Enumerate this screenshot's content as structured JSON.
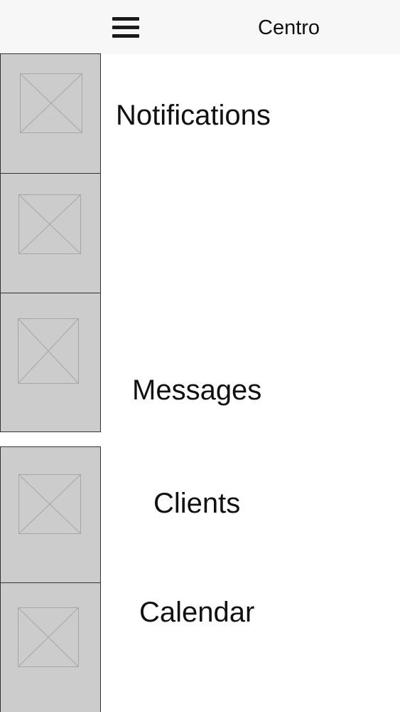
{
  "header": {
    "title": "Centro",
    "menu_icon": "hamburger-menu-icon"
  },
  "menu": {
    "items": [
      {
        "label": "Notifications",
        "icon": "image-placeholder-icon"
      },
      {
        "label": "",
        "icon": "image-placeholder-icon"
      },
      {
        "label": "Messages",
        "icon": "image-placeholder-icon"
      },
      {
        "label": "Clients",
        "icon": "image-placeholder-icon"
      },
      {
        "label": "Calendar",
        "icon": "image-placeholder-icon"
      }
    ]
  },
  "colors": {
    "header_background": "#f7f7f7",
    "placeholder_fill": "#cccccc",
    "placeholder_border": "#333333",
    "text": "#111111"
  }
}
